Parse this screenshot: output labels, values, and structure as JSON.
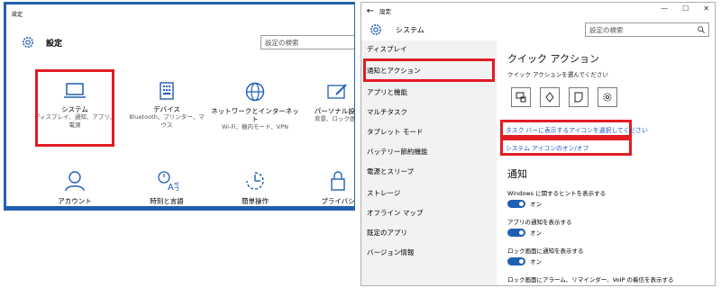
{
  "left": {
    "window_title": "設定",
    "header_title": "設定",
    "search_placeholder": "設定の検索",
    "items": [
      {
        "label": "システム",
        "sub1": "ディスプレイ、通知、アプリ、",
        "sub2": "電源"
      },
      {
        "label": "デバイス",
        "sub1": "Bluetooth、プリンター、マ",
        "sub2": "ウス"
      },
      {
        "label": "ネットワークとインターネット",
        "sub1": "Wi-Fi、機内モード、VPN",
        "sub2": ""
      },
      {
        "label": "パーソナル設定",
        "sub1": "背景、ロック画面",
        "sub2": ""
      },
      {
        "label": "アカウント"
      },
      {
        "label": "時刻と言語"
      },
      {
        "label": "簡単操作"
      },
      {
        "label": "プライバシ"
      }
    ]
  },
  "right": {
    "window_title": "設定",
    "back_glyph": "←",
    "min_glyph": "—",
    "max_glyph": "☐",
    "close_glyph": "✕",
    "header_title": "システム",
    "search_placeholder": "設定の検索",
    "sidebar": [
      "ディスプレイ",
      "通知とアクション",
      "アプリと機能",
      "マルチタスク",
      "タブレット モード",
      "バッテリー節約機能",
      "電源とスリープ",
      "ストレージ",
      "オフライン マップ",
      "既定のアプリ",
      "バージョン情報"
    ],
    "quick_title": "クイック アクション",
    "quick_note": "クイック アクションを選んでください",
    "link1": "タスク バーに表示するアイコンを選択してください",
    "link2": "システム アイコンのオン/オフ",
    "notify_title": "通知",
    "settings": [
      {
        "text": "Windows に関するヒントを表示する",
        "state": "オン"
      },
      {
        "text": "アプリの通知を表示する",
        "state": "オン"
      },
      {
        "text": "ロック画面に通知を表示する",
        "state": "オン"
      },
      {
        "text": "ロック画面にアラーム、リマインダー、VoIP の着信を表示する"
      }
    ]
  },
  "colors": {
    "accent": "#1f5fb3",
    "highlight": "#e11c23",
    "link": "#1a56c2",
    "sidebar_bg": "#f2f2f2"
  }
}
